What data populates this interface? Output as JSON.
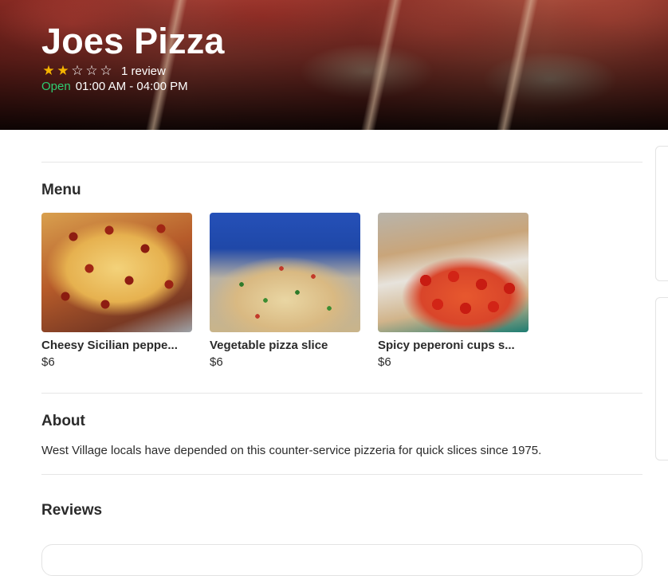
{
  "header": {
    "title": "Joes Pizza",
    "rating": 2,
    "rating_max": 5,
    "review_count": "1 review",
    "status": "Open",
    "hours": "01:00 AM - 04:00 PM"
  },
  "menu": {
    "title": "Menu",
    "items": [
      {
        "name": "Cheesy Sicilian peppe...",
        "price": "$6"
      },
      {
        "name": "Vegetable pizza slice",
        "price": "$6"
      },
      {
        "name": "Spicy peperoni cups s...",
        "price": "$6"
      }
    ]
  },
  "about": {
    "title": "About",
    "text": "West Village locals have depended on this counter-service pizzeria for quick slices since 1975."
  },
  "reviews": {
    "title": "Reviews"
  },
  "colors": {
    "star": "#f5b400",
    "open": "#2ecc71",
    "text": "#2b2b2b"
  }
}
